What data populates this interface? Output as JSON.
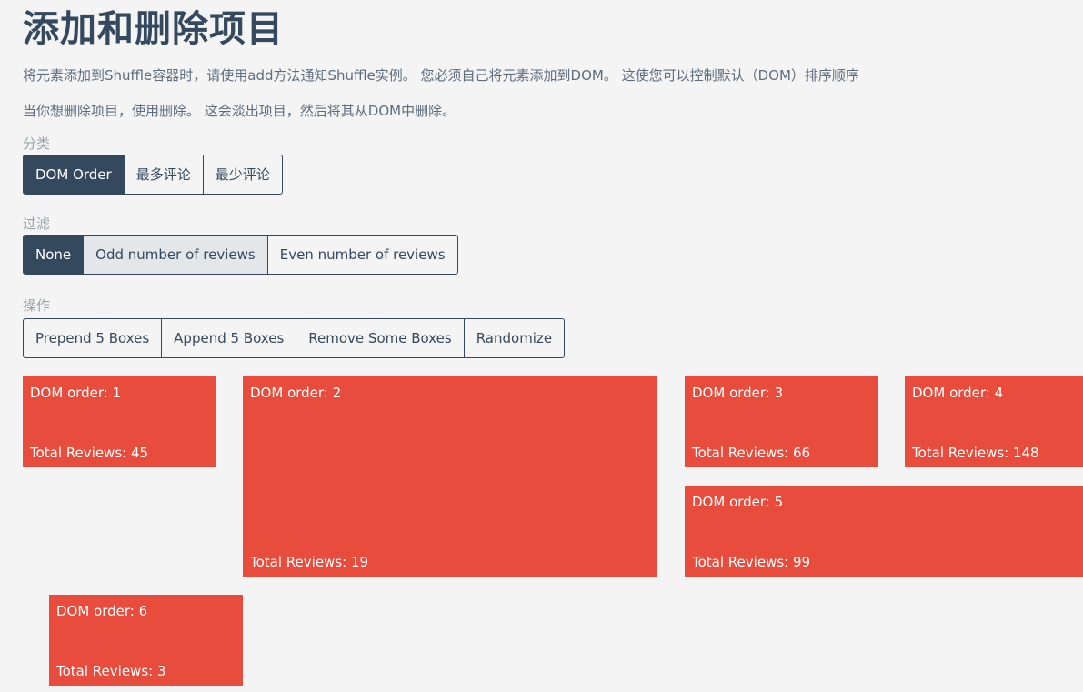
{
  "title": "添加和删除项目",
  "descriptions": [
    "将元素添加到Shuffle容器时，请使用add方法通知Shuffle实例。 您必须自己将元素添加到DOM。 这使您可以控制默认（DOM）排序顺序",
    "当你想删除项目，使用删除。 这会淡出项目，然后将其从DOM中删除。"
  ],
  "sort": {
    "label": "分类",
    "buttons": [
      "DOM Order",
      "最多评论",
      "最少评论"
    ],
    "active": "DOM Order"
  },
  "filter": {
    "label": "过滤",
    "buttons": [
      "None",
      "Odd number of reviews",
      "Even number of reviews"
    ],
    "active": "None"
  },
  "actions": {
    "label": "操作",
    "buttons": [
      "Prepend 5 Boxes",
      "Append 5 Boxes",
      "Remove Some Boxes",
      "Randomize"
    ]
  },
  "boxes": [
    {
      "order": "DOM order: 1",
      "reviews": "Total Reviews: 45"
    },
    {
      "order": "DOM order: 2",
      "reviews": "Total Reviews: 19"
    },
    {
      "order": "DOM order: 3",
      "reviews": "Total Reviews: 66"
    },
    {
      "order": "DOM order: 4",
      "reviews": "Total Reviews: 148"
    },
    {
      "order": "DOM order: 5",
      "reviews": "Total Reviews: 99"
    },
    {
      "order": "DOM order: 6",
      "reviews": "Total Reviews: 3"
    }
  ],
  "colors": {
    "accent": "#34495e",
    "box": "#e74c3c",
    "background": "#f4f4f4"
  }
}
